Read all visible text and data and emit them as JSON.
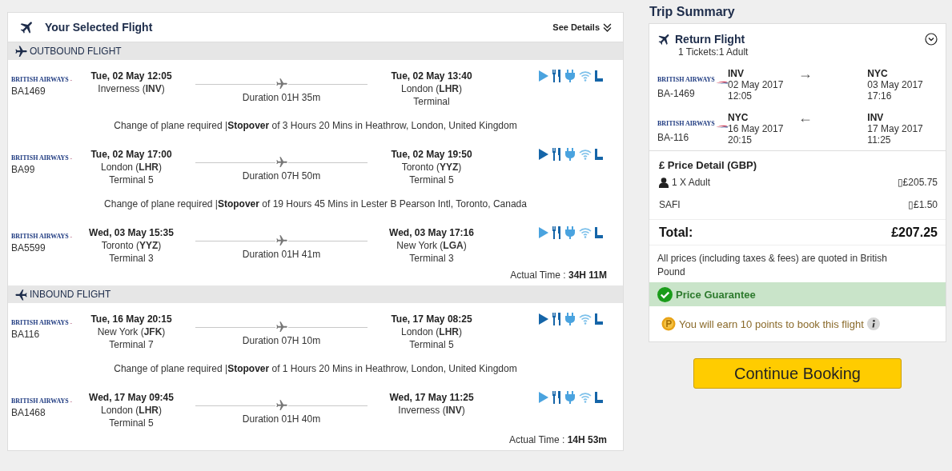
{
  "selected_flight": {
    "title": "Your Selected Flight",
    "details_link": "See Details",
    "sections": [
      {
        "kind": "outbound",
        "title": "OUTBOUND FLIGHT",
        "items": [
          {
            "kind": "segment",
            "airline": "BRITISH AIRWAYS",
            "flight": "BA1469",
            "dep": {
              "time": "Tue, 02 May 12:05",
              "place": "Inverness (**INV**)"
            },
            "duration": "Duration 01H 35m",
            "arr": {
              "time": "Tue, 02 May 13:40",
              "place": "London (**LHR**)",
              "terminal": "Terminal"
            },
            "entertainment": false
          },
          {
            "kind": "stopover",
            "text": "Change of plane required |**Stopover**  of 3 Hours 20 Mins in Heathrow, London, United Kingdom"
          },
          {
            "kind": "segment",
            "airline": "BRITISH AIRWAYS",
            "flight": "BA99",
            "dep": {
              "time": "Tue, 02 May 17:00",
              "place": "London (**LHR**)",
              "terminal": "Terminal 5"
            },
            "duration": "Duration 07H 50m",
            "arr": {
              "time": "Tue, 02 May 19:50",
              "place": "Toronto (**YYZ**)",
              "terminal": "Terminal 5"
            },
            "entertainment": true
          },
          {
            "kind": "stopover",
            "text": "Change of plane required |**Stopover**  of 19 Hours 45 Mins in Lester B Pearson Intl, Toronto, Canada"
          },
          {
            "kind": "segment",
            "airline": "BRITISH AIRWAYS",
            "flight": "BA5599",
            "dep": {
              "time": "Wed, 03 May 15:35",
              "place": "Toronto (**YYZ**)",
              "terminal": "Terminal 3"
            },
            "duration": "Duration 01H 41m",
            "arr": {
              "time": "Wed, 03 May 17:16",
              "place": "New York (**LGA**)",
              "terminal": "Terminal 3"
            },
            "entertainment": false
          }
        ],
        "actual_time": "Actual Time : **34H 11M**"
      },
      {
        "kind": "inbound",
        "title": "INBOUND FLIGHT",
        "items": [
          {
            "kind": "segment",
            "airline": "BRITISH AIRWAYS",
            "flight": "BA116",
            "dep": {
              "time": "Tue, 16 May 20:15",
              "place": "New York (**JFK**)",
              "terminal": "Terminal 7"
            },
            "duration": "Duration 07H 10m",
            "arr": {
              "time": "Tue, 17 May 08:25",
              "place": "London (**LHR**)",
              "terminal": "Terminal 5"
            },
            "entertainment": true
          },
          {
            "kind": "stopover",
            "text": "Change of plane required |**Stopover**  of 1 Hours 20 Mins in Heathrow, London, United Kingdom"
          },
          {
            "kind": "segment",
            "airline": "BRITISH AIRWAYS",
            "flight": "BA1468",
            "dep": {
              "time": "Wed, 17 May 09:45",
              "place": "London (**LHR**)",
              "terminal": "Terminal 5"
            },
            "duration": "Duration 01H 40m",
            "arr": {
              "time": "Wed, 17 May 11:25",
              "place": "Inverness (**INV**)"
            },
            "entertainment": false
          }
        ],
        "actual_time": "Actual Time : **14H 53m**"
      }
    ]
  },
  "trip_summary": {
    "title": "Trip Summary",
    "trip_type": "Return Flight",
    "tickets": "1 Tickets:1 Adult",
    "legs": [
      {
        "airline": "BRITISH AIRWAYS",
        "flight": "BA-1469",
        "from": {
          "code": "INV",
          "date": "02 May 2017",
          "time": "12:05"
        },
        "arrow": "→",
        "to": {
          "code": "NYC",
          "date": "03 May 2017",
          "time": "17:16"
        }
      },
      {
        "airline": "BRITISH AIRWAYS",
        "flight": "BA-116",
        "from": {
          "code": "NYC",
          "date": "16 May 2017",
          "time": "20:15"
        },
        "arrow": "←",
        "to": {
          "code": "INV",
          "date": "17 May 2017",
          "time": "11:25"
        }
      }
    ],
    "price_title": "£ Price Detail (GBP)",
    "price_lines": [
      {
        "kind": "person",
        "label": "1 X Adult",
        "amount": "▯£205.75"
      },
      {
        "kind": "plain",
        "label": "SAFI",
        "amount": "▯£1.50"
      }
    ],
    "total_label": "Total:",
    "total": "£207.25",
    "note": "All prices (including taxes & fees) are quoted in British Pound",
    "guarantee": "Price Guarantee",
    "points": "You will earn 10 points to book this flight"
  },
  "continue_button": "Continue Booking"
}
